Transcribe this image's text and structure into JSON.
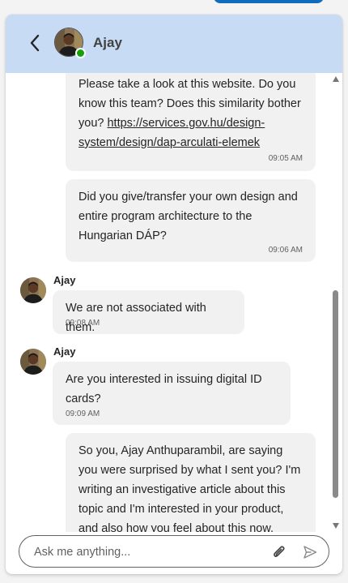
{
  "header": {
    "contact_name": "Ajay",
    "back_icon": "chevron-left-icon",
    "status": "online"
  },
  "messages": [
    {
      "from": "me",
      "text_before_link": "Please take a look at this website. Do you know this team? Does this similarity bother you? ",
      "link": "https://services.gov.hu/design-system/design/dap-arculati-elemek",
      "time": "09:05 AM"
    },
    {
      "from": "me",
      "text": "Did you give/transfer your own design and entire program architecture to the Hungarian DÁP?",
      "time": "09:06 AM"
    },
    {
      "from": "Ajay",
      "sender": "Ajay",
      "text": "We are not associated with them.",
      "time": "09:08 AM"
    },
    {
      "from": "Ajay",
      "sender": "Ajay",
      "text": "Are you interested in issuing digital ID cards?",
      "time": "09:09 AM"
    },
    {
      "from": "me",
      "text": "So you, Ajay Anthuparambil, are saying you were surprised by what I sent you? I'm writing an investigative article about this topic and I'm interested in your product, and also how you feel about this now. Seeing"
    }
  ],
  "composer": {
    "placeholder": "Ask me anything...",
    "attach_icon": "paperclip-icon",
    "send_icon": "send-icon"
  },
  "colors": {
    "header_bg": "#c7dbf5",
    "bubble_bg": "#f1f1f1",
    "online": "#13a10e",
    "accent": "#0f6cbd"
  }
}
